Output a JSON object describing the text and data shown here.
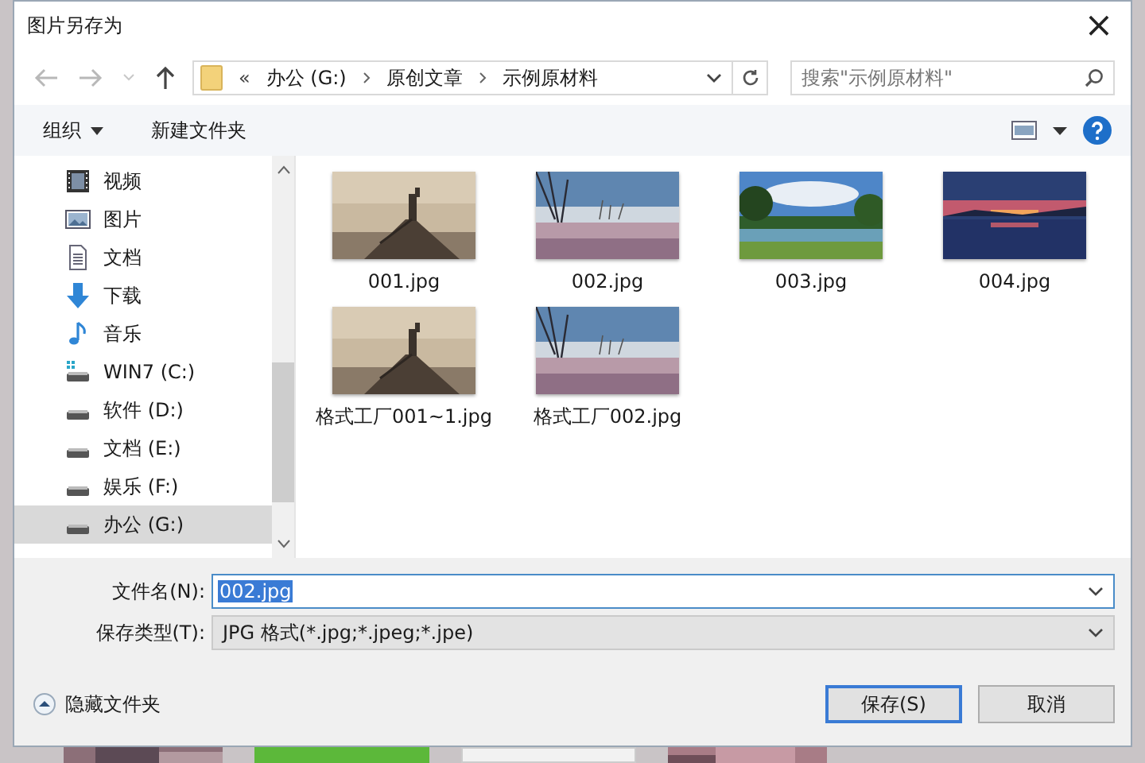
{
  "window": {
    "title": "图片另存为",
    "close": "×"
  },
  "address": {
    "overflow": "«",
    "crumbs": [
      "办公 (G:)",
      "原创文章",
      "示例原材料"
    ]
  },
  "search": {
    "placeholder": "搜索\"示例原材料\""
  },
  "toolbar": {
    "organize": "组织",
    "new_folder": "新建文件夹"
  },
  "sidebar": {
    "items": [
      {
        "label": "视频",
        "kind": "video",
        "selected": false
      },
      {
        "label": "图片",
        "kind": "pictures",
        "selected": false
      },
      {
        "label": "文档",
        "kind": "document",
        "selected": false
      },
      {
        "label": "下载",
        "kind": "download",
        "selected": false
      },
      {
        "label": "音乐",
        "kind": "music",
        "selected": false
      },
      {
        "label": "WIN7 (C:)",
        "kind": "system-drive",
        "selected": false
      },
      {
        "label": "软件 (D:)",
        "kind": "drive",
        "selected": false
      },
      {
        "label": "文档 (E:)",
        "kind": "drive",
        "selected": false
      },
      {
        "label": "娱乐 (F:)",
        "kind": "drive",
        "selected": false
      },
      {
        "label": "办公 (G:)",
        "kind": "drive",
        "selected": true
      }
    ]
  },
  "files": [
    {
      "name": "001.jpg",
      "kind": "picture"
    },
    {
      "name": "002.jpg",
      "kind": "picture"
    },
    {
      "name": "003.jpg",
      "kind": "picture"
    },
    {
      "name": "004.jpg",
      "kind": "picture"
    },
    {
      "name": "格式工厂001~1.jpg",
      "kind": "picture"
    },
    {
      "name": "格式工厂002.jpg",
      "kind": "picture"
    }
  ],
  "filename": {
    "label": "文件名(N):",
    "value": "002.jpg"
  },
  "filetype": {
    "label": "保存类型(T):",
    "value": "JPG 格式(*.jpg;*.jpeg;*.jpe)"
  },
  "hide_folders": "隐藏文件夹",
  "buttons": [
    {
      "label": "保存(S)",
      "default": true
    },
    {
      "label": "取消",
      "default": false
    }
  ]
}
